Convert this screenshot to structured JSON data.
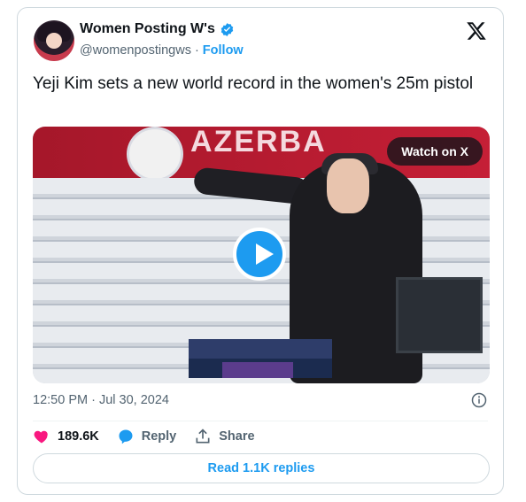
{
  "author": {
    "name": "Women Posting W's",
    "handle": "@womenpostingws",
    "separator": "·",
    "follow_label": "Follow"
  },
  "tweet": {
    "text": "Yeji Kim sets a new world record in the women's 25m pistol"
  },
  "media": {
    "watch_label": "Watch on X",
    "banner_text": "AZERBA"
  },
  "timestamp": "12:50 PM · Jul 30, 2024",
  "actions": {
    "likes": "189.6K",
    "reply_label": "Reply",
    "share_label": "Share"
  },
  "replies_button": "Read 1.1K replies",
  "colors": {
    "accent": "#1d9bf0",
    "like": "#f91880",
    "text": "#0f1419",
    "muted": "#536471"
  }
}
